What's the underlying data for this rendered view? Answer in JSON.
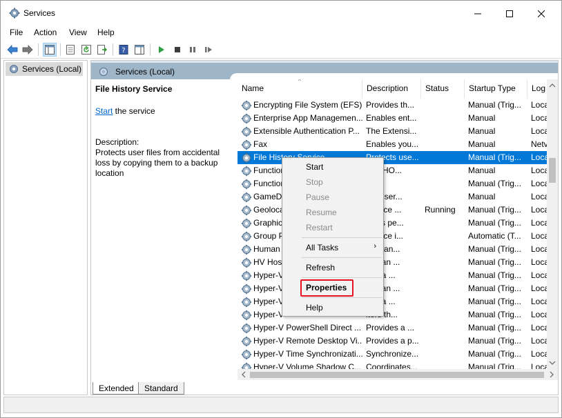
{
  "window": {
    "title": "Services"
  },
  "menubar": [
    "File",
    "Action",
    "View",
    "Help"
  ],
  "tree": {
    "root": "Services (Local)"
  },
  "header": {
    "title": "Services (Local)"
  },
  "description": {
    "service_name": "File History Service",
    "start_link": "Start",
    "start_suffix": " the service",
    "label": "Description:",
    "text": "Protects user files from accidental loss by copying them to a backup location"
  },
  "columns": [
    "Name",
    "Description",
    "Status",
    "Startup Type",
    "Log"
  ],
  "rows": [
    {
      "name": "Encrypting File System (EFS)",
      "desc": "Provides th...",
      "status": "",
      "startup": "Manual (Trig...",
      "log": "Loca"
    },
    {
      "name": "Enterprise App Managemen...",
      "desc": "Enables ent...",
      "status": "",
      "startup": "Manual",
      "log": "Loca"
    },
    {
      "name": "Extensible Authentication P...",
      "desc": "The Extensi...",
      "status": "",
      "startup": "Manual",
      "log": "Loca"
    },
    {
      "name": "Fax",
      "desc": "Enables you...",
      "status": "",
      "startup": "Manual",
      "log": "Netv"
    },
    {
      "name": "File History Service",
      "desc": "Protects use...",
      "status": "",
      "startup": "Manual (Trig...",
      "log": "Loca",
      "selected": true
    },
    {
      "name": "Function",
      "desc": "FDPHO...",
      "status": "",
      "startup": "Manual",
      "log": "Loca"
    },
    {
      "name": "Function",
      "desc": "",
      "status": "",
      "startup": "Manual (Trig...",
      "log": "Loca"
    },
    {
      "name": "GameDV",
      "desc": "user ser...",
      "status": "",
      "startup": "Manual",
      "log": "Loca"
    },
    {
      "name": "Geoloca",
      "desc": "service ...",
      "status": "Running",
      "startup": "Manual (Trig...",
      "log": "Loca"
    },
    {
      "name": "Graphic",
      "desc": "phics pe...",
      "status": "",
      "startup": "Manual (Trig...",
      "log": "Loca"
    },
    {
      "name": "Group P",
      "desc": "service i...",
      "status": "",
      "startup": "Automatic (T...",
      "log": "Loca"
    },
    {
      "name": "Human",
      "desc": "ates an...",
      "status": "",
      "startup": "Manual (Trig...",
      "log": "Loca"
    },
    {
      "name": "HV Host",
      "desc": "des an ...",
      "status": "",
      "startup": "Manual (Trig...",
      "log": "Loca"
    },
    {
      "name": "Hyper-V",
      "desc": "des a ...",
      "status": "",
      "startup": "Manual (Trig...",
      "log": "Loca"
    },
    {
      "name": "Hyper-V",
      "desc": "des an ...",
      "status": "",
      "startup": "Manual (Trig...",
      "log": "Loca"
    },
    {
      "name": "Hyper-V",
      "desc": "des a ...",
      "status": "",
      "startup": "Manual (Trig...",
      "log": "Loca"
    },
    {
      "name": "Hyper-V",
      "desc": "itors th...",
      "status": "",
      "startup": "Manual (Trig...",
      "log": "Loca"
    },
    {
      "name": "Hyper-V PowerShell Direct ...",
      "desc": "Provides a ...",
      "status": "",
      "startup": "Manual (Trig...",
      "log": "Loca"
    },
    {
      "name": "Hyper-V Remote Desktop Vi...",
      "desc": "Provides a p...",
      "status": "",
      "startup": "Manual (Trig...",
      "log": "Loca"
    },
    {
      "name": "Hyper-V Time Synchronizati...",
      "desc": "Synchronize...",
      "status": "",
      "startup": "Manual (Trig...",
      "log": "Loca"
    },
    {
      "name": "Hyper-V Volume Shadow C...",
      "desc": "Coordinates...",
      "status": "",
      "startup": "Manual (Trig...",
      "log": "Loca"
    }
  ],
  "context_menu": {
    "start": "Start",
    "stop": "Stop",
    "pause": "Pause",
    "resume": "Resume",
    "restart": "Restart",
    "all_tasks": "All Tasks",
    "refresh": "Refresh",
    "properties": "Properties",
    "help": "Help"
  },
  "tabs": {
    "extended": "Extended",
    "standard": "Standard"
  },
  "colors": {
    "selection": "#0078d7",
    "highlight": "#e81123",
    "header": "#9fb5c8"
  }
}
